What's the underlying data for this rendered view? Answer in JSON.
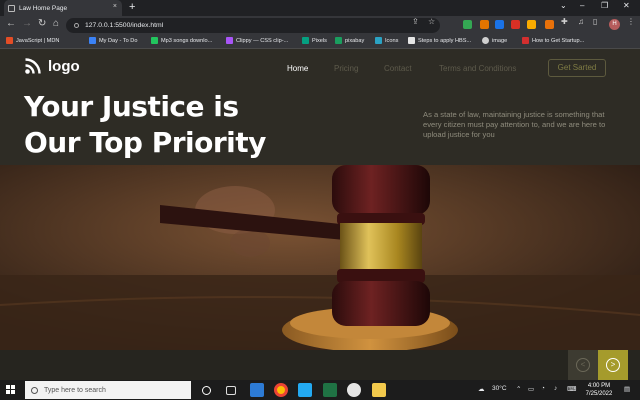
{
  "browser": {
    "tab_title": "Law Home Page",
    "tab_close": "×",
    "new_tab": "+",
    "url": "127.0.0.1:5500/index.html",
    "profile_initial": "H",
    "window_controls": [
      "⌄",
      "–",
      "❐",
      "✕"
    ],
    "bookmarks": [
      {
        "label": "JavaScript | MDN",
        "color": "#e44d26"
      },
      {
        "label": "My Day - To Do",
        "color": "#3b82f6"
      },
      {
        "label": "Mp3 songs downlo...",
        "color": "#22c55e"
      },
      {
        "label": "Clippy — CSS clip-...",
        "color": "#a855f7"
      },
      {
        "label": "Pixels",
        "color": "#05a081"
      },
      {
        "label": "pixabay",
        "color": "#1a9e5f"
      },
      {
        "label": "Icons",
        "color": "#2ba3c4"
      },
      {
        "label": "Steps to apply HBS...",
        "color": "#e5e5e5"
      },
      {
        "label": "image",
        "color": "#cfcfcf"
      },
      {
        "label": "How to Get Startup...",
        "color": "#d32f2f"
      }
    ]
  },
  "site": {
    "logo_text": "logo",
    "nav": [
      "Home",
      "Pricing",
      "Contact",
      "Terms and Conditions"
    ],
    "cta": "Get Sarted",
    "hero_title_line1": "Your Justice is",
    "hero_title_line2": "Our Top Priority",
    "hero_description": "As a state of law, maintaining justice is something that every citizen must pay attention to, and we are here to upload justice for you",
    "prev_arrow": "<",
    "next_arrow": ">"
  },
  "taskbar": {
    "search_placeholder": "Type here to search",
    "temperature": "30°C",
    "time": "4:00 PM",
    "date": "7/25/2022"
  },
  "colors": {
    "page_bg": "#2e2c25",
    "accent": "#a59b2c",
    "muted_nav": "#5e5b4c"
  }
}
